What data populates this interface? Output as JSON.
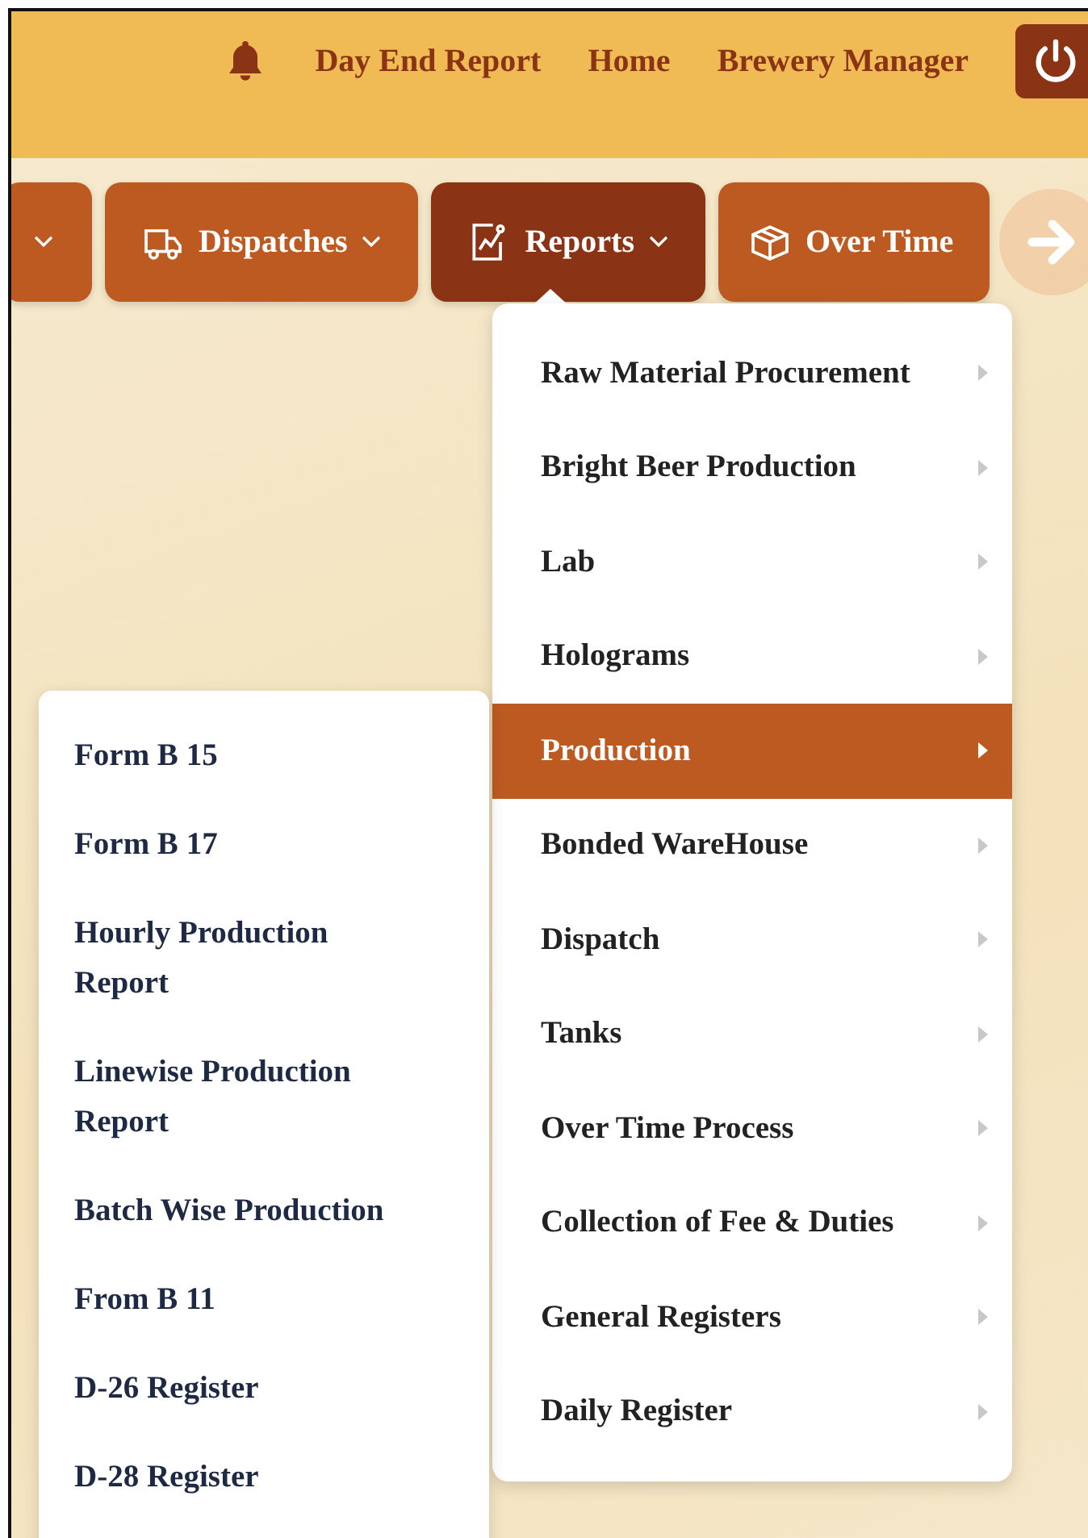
{
  "header": {
    "links": [
      "Day End Report",
      "Home",
      "Brewery Manager"
    ]
  },
  "nav_tabs": [
    {
      "selected": false,
      "kind": "partial"
    },
    {
      "label": "Dispatches",
      "selected": false,
      "kind": "truck"
    },
    {
      "label": "Reports",
      "selected": true,
      "kind": "chart"
    },
    {
      "label": "Over Time",
      "selected": false,
      "kind": "box"
    }
  ],
  "reports_menu": [
    {
      "label": "Raw Material Procurement",
      "selected": false
    },
    {
      "label": "Bright Beer Production",
      "selected": false
    },
    {
      "label": "Lab",
      "selected": false
    },
    {
      "label": "Holograms",
      "selected": false
    },
    {
      "label": "Production",
      "selected": true,
      "children": [
        "Form B 15",
        "Form B 17",
        "Hourly Production Report",
        "Linewise Production Report",
        "Batch Wise Production",
        "From B 11",
        "D-26 Register",
        "D-28 Register"
      ]
    },
    {
      "label": "Bonded WareHouse",
      "selected": false
    },
    {
      "label": "Dispatch",
      "selected": false
    },
    {
      "label": "Tanks",
      "selected": false
    },
    {
      "label": "Over Time Process",
      "selected": false
    },
    {
      "label": "Collection of Fee & Duties",
      "selected": false
    },
    {
      "label": "General Registers",
      "selected": false
    },
    {
      "label": "Daily Register",
      "selected": false
    }
  ]
}
